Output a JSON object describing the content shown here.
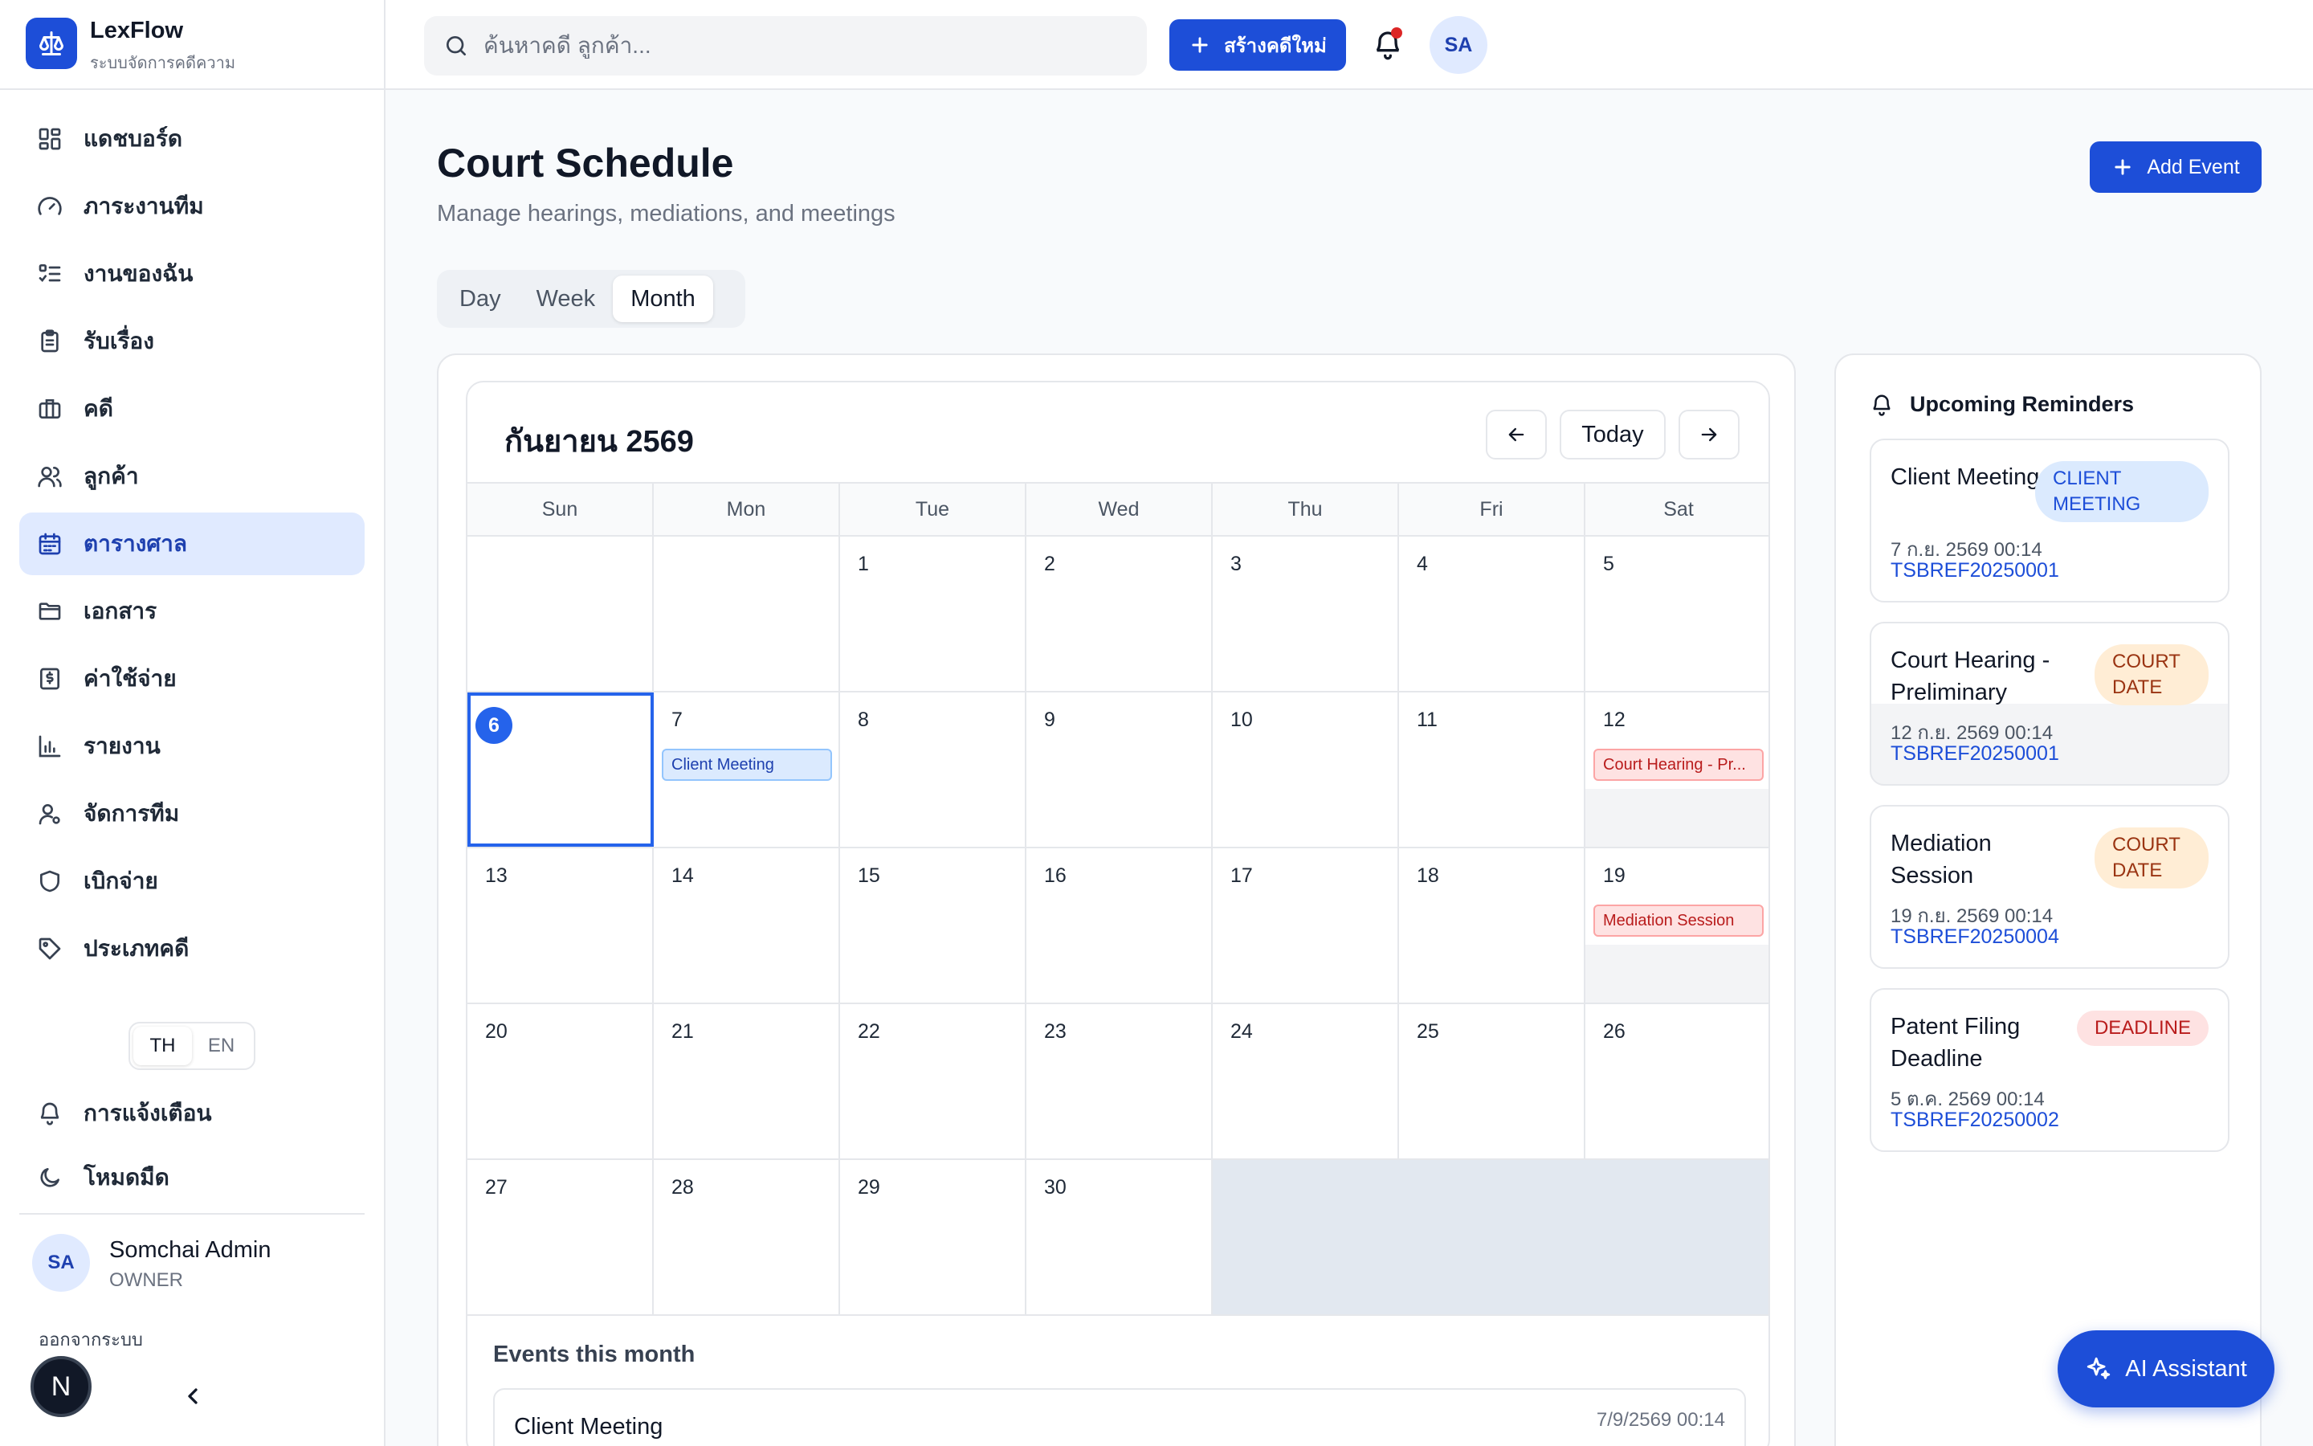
{
  "brand": {
    "name": "LexFlow",
    "subtitle": "ระบบจัดการคดีความ"
  },
  "sidebar": {
    "items": [
      {
        "label": "แดชบอร์ด",
        "icon": "grid-icon"
      },
      {
        "label": "ภาระงานทีม",
        "icon": "gauge-icon"
      },
      {
        "label": "งานของฉัน",
        "icon": "checklist-icon"
      },
      {
        "label": "รับเรื่อง",
        "icon": "clipboard-icon"
      },
      {
        "label": "คดี",
        "icon": "briefcase-icon"
      },
      {
        "label": "ลูกค้า",
        "icon": "users-icon"
      },
      {
        "label": "ตารางศาล",
        "icon": "calendar-icon",
        "active": true
      },
      {
        "label": "เอกสาร",
        "icon": "folder-icon"
      },
      {
        "label": "ค่าใช้จ่าย",
        "icon": "receipt-icon"
      },
      {
        "label": "รายงาน",
        "icon": "bar-chart-icon"
      },
      {
        "label": "จัดการทีม",
        "icon": "user-gear-icon"
      },
      {
        "label": "เบิกจ่าย",
        "icon": "shield-icon"
      },
      {
        "label": "ประเภทคดี",
        "icon": "tag-icon"
      }
    ],
    "lang": {
      "th": "TH",
      "en": "EN",
      "selected": "TH"
    },
    "notifications_label": "การแจ้งเตือน",
    "dark_mode_label": "โหมดมืด",
    "user": {
      "initials": "SA",
      "name": "Somchai Admin",
      "role": "OWNER"
    },
    "logout_label": "ออกจากระบบ",
    "next_badge": "N"
  },
  "topbar": {
    "search_placeholder": "ค้นหาคดี ลูกค้า...",
    "new_case_label": "สร้างคดีใหม่",
    "avatar_initials": "SA"
  },
  "page": {
    "title": "Court Schedule",
    "subtitle": "Manage hearings, mediations, and meetings",
    "add_event_label": "Add Event",
    "view_tabs": [
      "Day",
      "Week",
      "Month"
    ],
    "active_view": "Month"
  },
  "calendar": {
    "month_label": "กันยายน 2569",
    "today_label": "Today",
    "weekdays": [
      "Sun",
      "Mon",
      "Tue",
      "Wed",
      "Thu",
      "Fri",
      "Sat"
    ],
    "weeks": [
      [
        null,
        null,
        1,
        2,
        3,
        4,
        5
      ],
      [
        6,
        7,
        8,
        9,
        10,
        11,
        12
      ],
      [
        13,
        14,
        15,
        16,
        17,
        18,
        19
      ],
      [
        20,
        21,
        22,
        23,
        24,
        25,
        26
      ],
      [
        27,
        28,
        29,
        30,
        null,
        null,
        null
      ]
    ],
    "today": 6,
    "events": [
      {
        "day": 7,
        "label": "Client Meeting",
        "color": "blue"
      },
      {
        "day": 12,
        "label": "Court Hearing - Pr...",
        "color": "red"
      },
      {
        "day": 19,
        "label": "Mediation Session",
        "color": "red"
      }
    ],
    "events_title": "Events this month",
    "first_event": {
      "title": "Client Meeting",
      "date": "7/9/2569 00:14"
    }
  },
  "reminders": {
    "title": "Upcoming Reminders",
    "items": [
      {
        "name": "Client Meeting",
        "badge": "CLIENT MEETING",
        "type": "meet",
        "date": "7 ก.ย. 2569 00:14",
        "ref": "TSBREF20250001"
      },
      {
        "name": "Court Hearing - Preliminary",
        "badge": "COURT DATE",
        "type": "court",
        "date": "12 ก.ย. 2569 00:14",
        "ref": "TSBREF20250001"
      },
      {
        "name": "Mediation Session",
        "badge": "COURT DATE",
        "type": "court",
        "date": "19 ก.ย. 2569 00:14",
        "ref": "TSBREF20250004"
      },
      {
        "name": "Patent Filing Deadline",
        "badge": "DEADLINE",
        "type": "dead",
        "date": "5 ต.ค. 2569 00:14",
        "ref": "TSBREF20250002"
      }
    ]
  },
  "ai_assistant_label": "AI Assistant",
  "colors": {
    "primary": "#1d4ed8",
    "active_bg": "#e0eaff",
    "today": "#2563eb"
  }
}
